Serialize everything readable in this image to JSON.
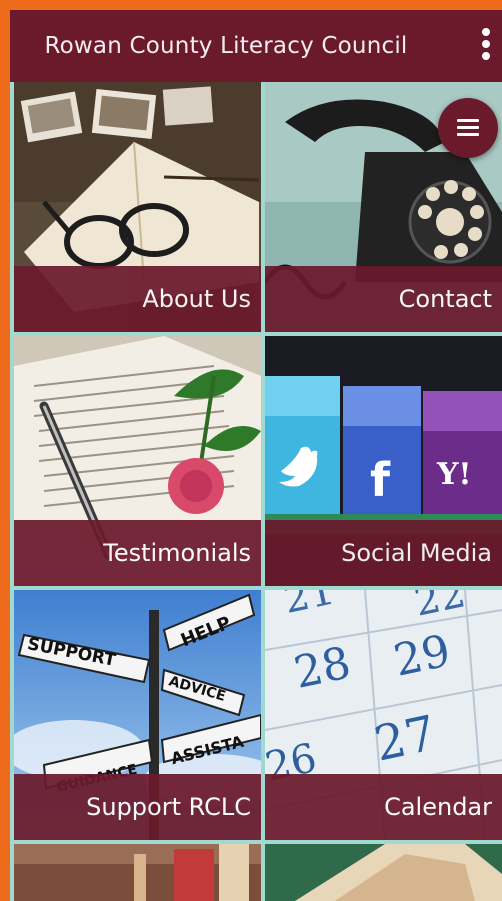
{
  "app": {
    "title": "Rowan County Literacy Council",
    "menu_icon": "more-vert-icon",
    "fab_icon": "hamburger-menu-icon"
  },
  "tiles": [
    {
      "label": "About Us",
      "image": "book-glasses-photo"
    },
    {
      "label": "Contact",
      "image": "rotary-telephone-photo"
    },
    {
      "label": "Testimonials",
      "image": "open-book-pen-rose-photo"
    },
    {
      "label": "Social Media",
      "image": "social-chalk-blocks-photo"
    },
    {
      "label": "Support RCLC",
      "image": "signpost-help-support-photo"
    },
    {
      "label": "Calendar",
      "image": "calendar-pages-photo"
    }
  ],
  "colors": {
    "accent_border": "#ef6b1c",
    "primary": "#6b1a2c",
    "grid_lines": "#9fd9d0"
  }
}
